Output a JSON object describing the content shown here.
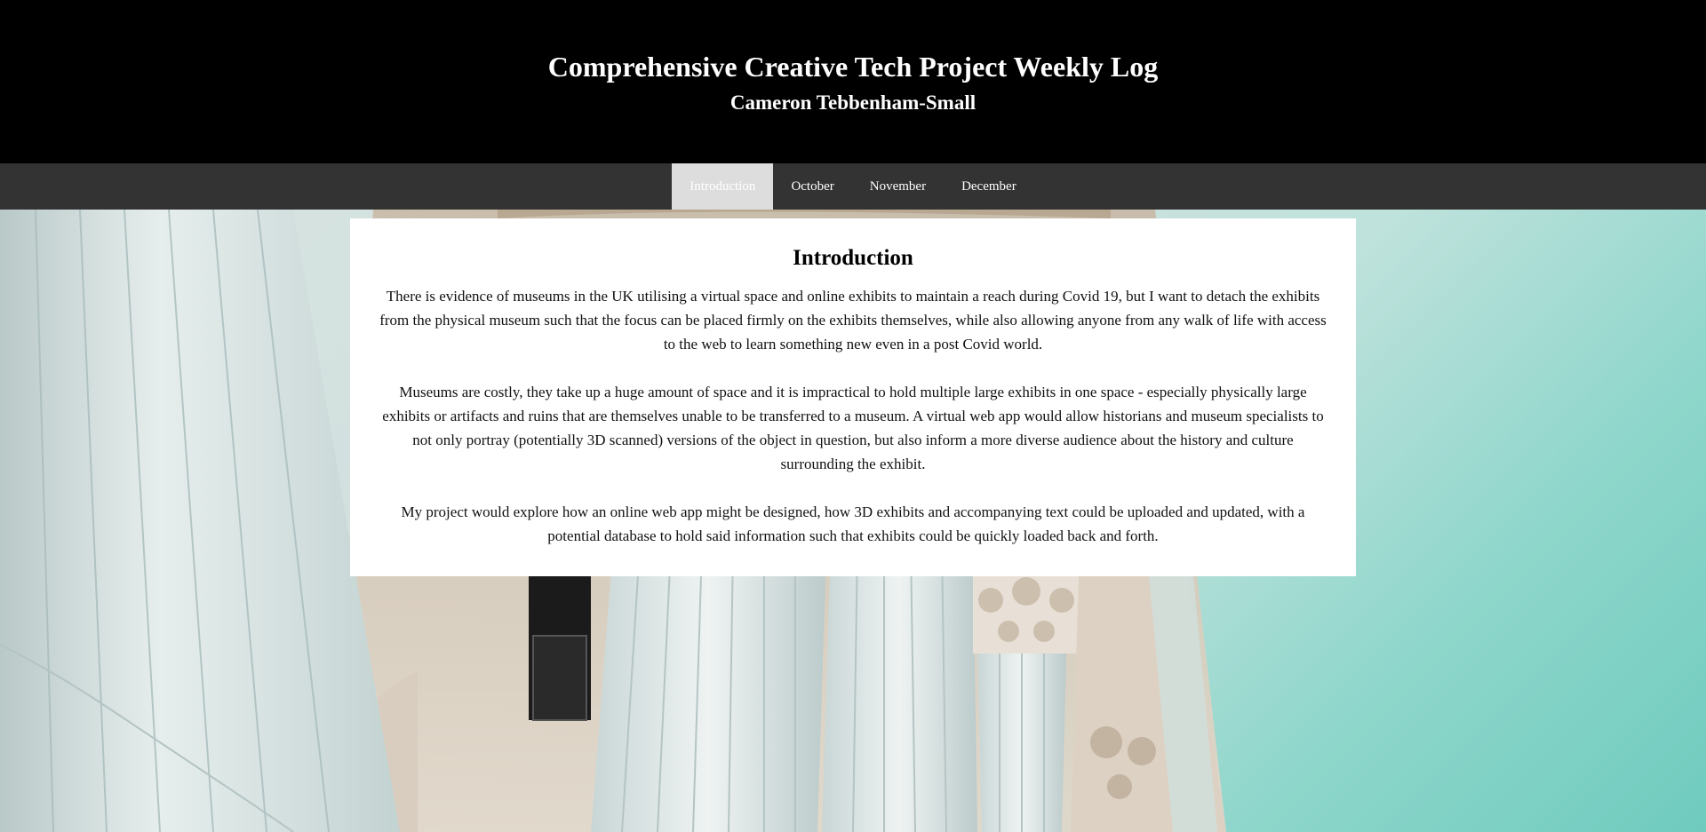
{
  "header": {
    "title": "Comprehensive Creative Tech Project Weekly Log",
    "subtitle": "Cameron Tebbenham-Small"
  },
  "nav": {
    "items": [
      {
        "label": "Introduction",
        "active": true
      },
      {
        "label": "October",
        "active": false
      },
      {
        "label": "November",
        "active": false
      },
      {
        "label": "December",
        "active": false
      }
    ]
  },
  "content": {
    "heading": "Introduction",
    "paragraphs": [
      "There is evidence of museums in the UK utilising a virtual space and online exhibits to maintain a reach during Covid 19, but I want to detach the exhibits from the physical museum such that the focus can be placed firmly on the exhibits themselves, while also allowing anyone from any walk of life with access to the web to learn something new even in a post Covid world.",
      "Museums are costly, they take up a huge amount of space and it is impractical to hold multiple large exhibits in one space - especially physically large exhibits or artifacts and ruins that are themselves unable to be transferred to a museum. A virtual web app would allow historians and museum specialists to not only portray (potentially 3D scanned) versions of the object in question, but also inform a more diverse audience about the history and culture surrounding the exhibit.",
      "My project would explore how an online web app might be designed, how 3D exhibits and accompanying text could be uploaded and updated, with a potential database to hold said information such that exhibits could be quickly loaded back and forth."
    ]
  },
  "colors": {
    "header_bg": "#000000",
    "nav_bg": "#333333",
    "nav_active_bg": "#dddddd",
    "sky_teal": "#6fcbbe"
  }
}
